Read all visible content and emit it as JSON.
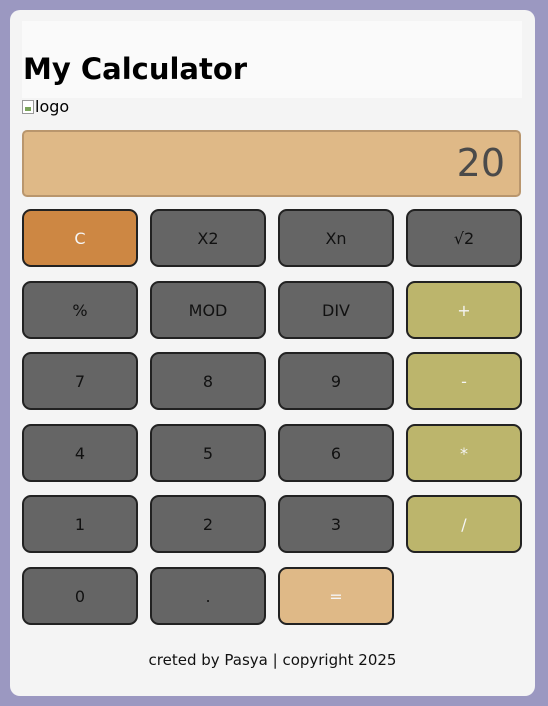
{
  "app": {
    "title": "My Calculator",
    "logo_alt": "logo"
  },
  "display": {
    "value": "20"
  },
  "buttons": {
    "clear": "C",
    "square": "X2",
    "power": "Xn",
    "sqrt": "√2",
    "percent": "%",
    "mod": "MOD",
    "div_int": "DIV",
    "plus": "+",
    "seven": "7",
    "eight": "8",
    "nine": "9",
    "minus": "-",
    "four": "4",
    "five": "5",
    "six": "6",
    "multiply": "*",
    "one": "1",
    "two": "2",
    "three": "3",
    "divide": "/",
    "zero": "0",
    "dot": ".",
    "equals": "="
  },
  "footer": {
    "text": "creted by Pasya | copyright 2025"
  },
  "colors": {
    "page_bg": "#9b98c1",
    "card_bg": "#f4f4f4",
    "display_bg": "#dfb987",
    "clear_btn": "#cd8743",
    "operator_btn": "#bcb56c",
    "number_btn": "#656565"
  }
}
